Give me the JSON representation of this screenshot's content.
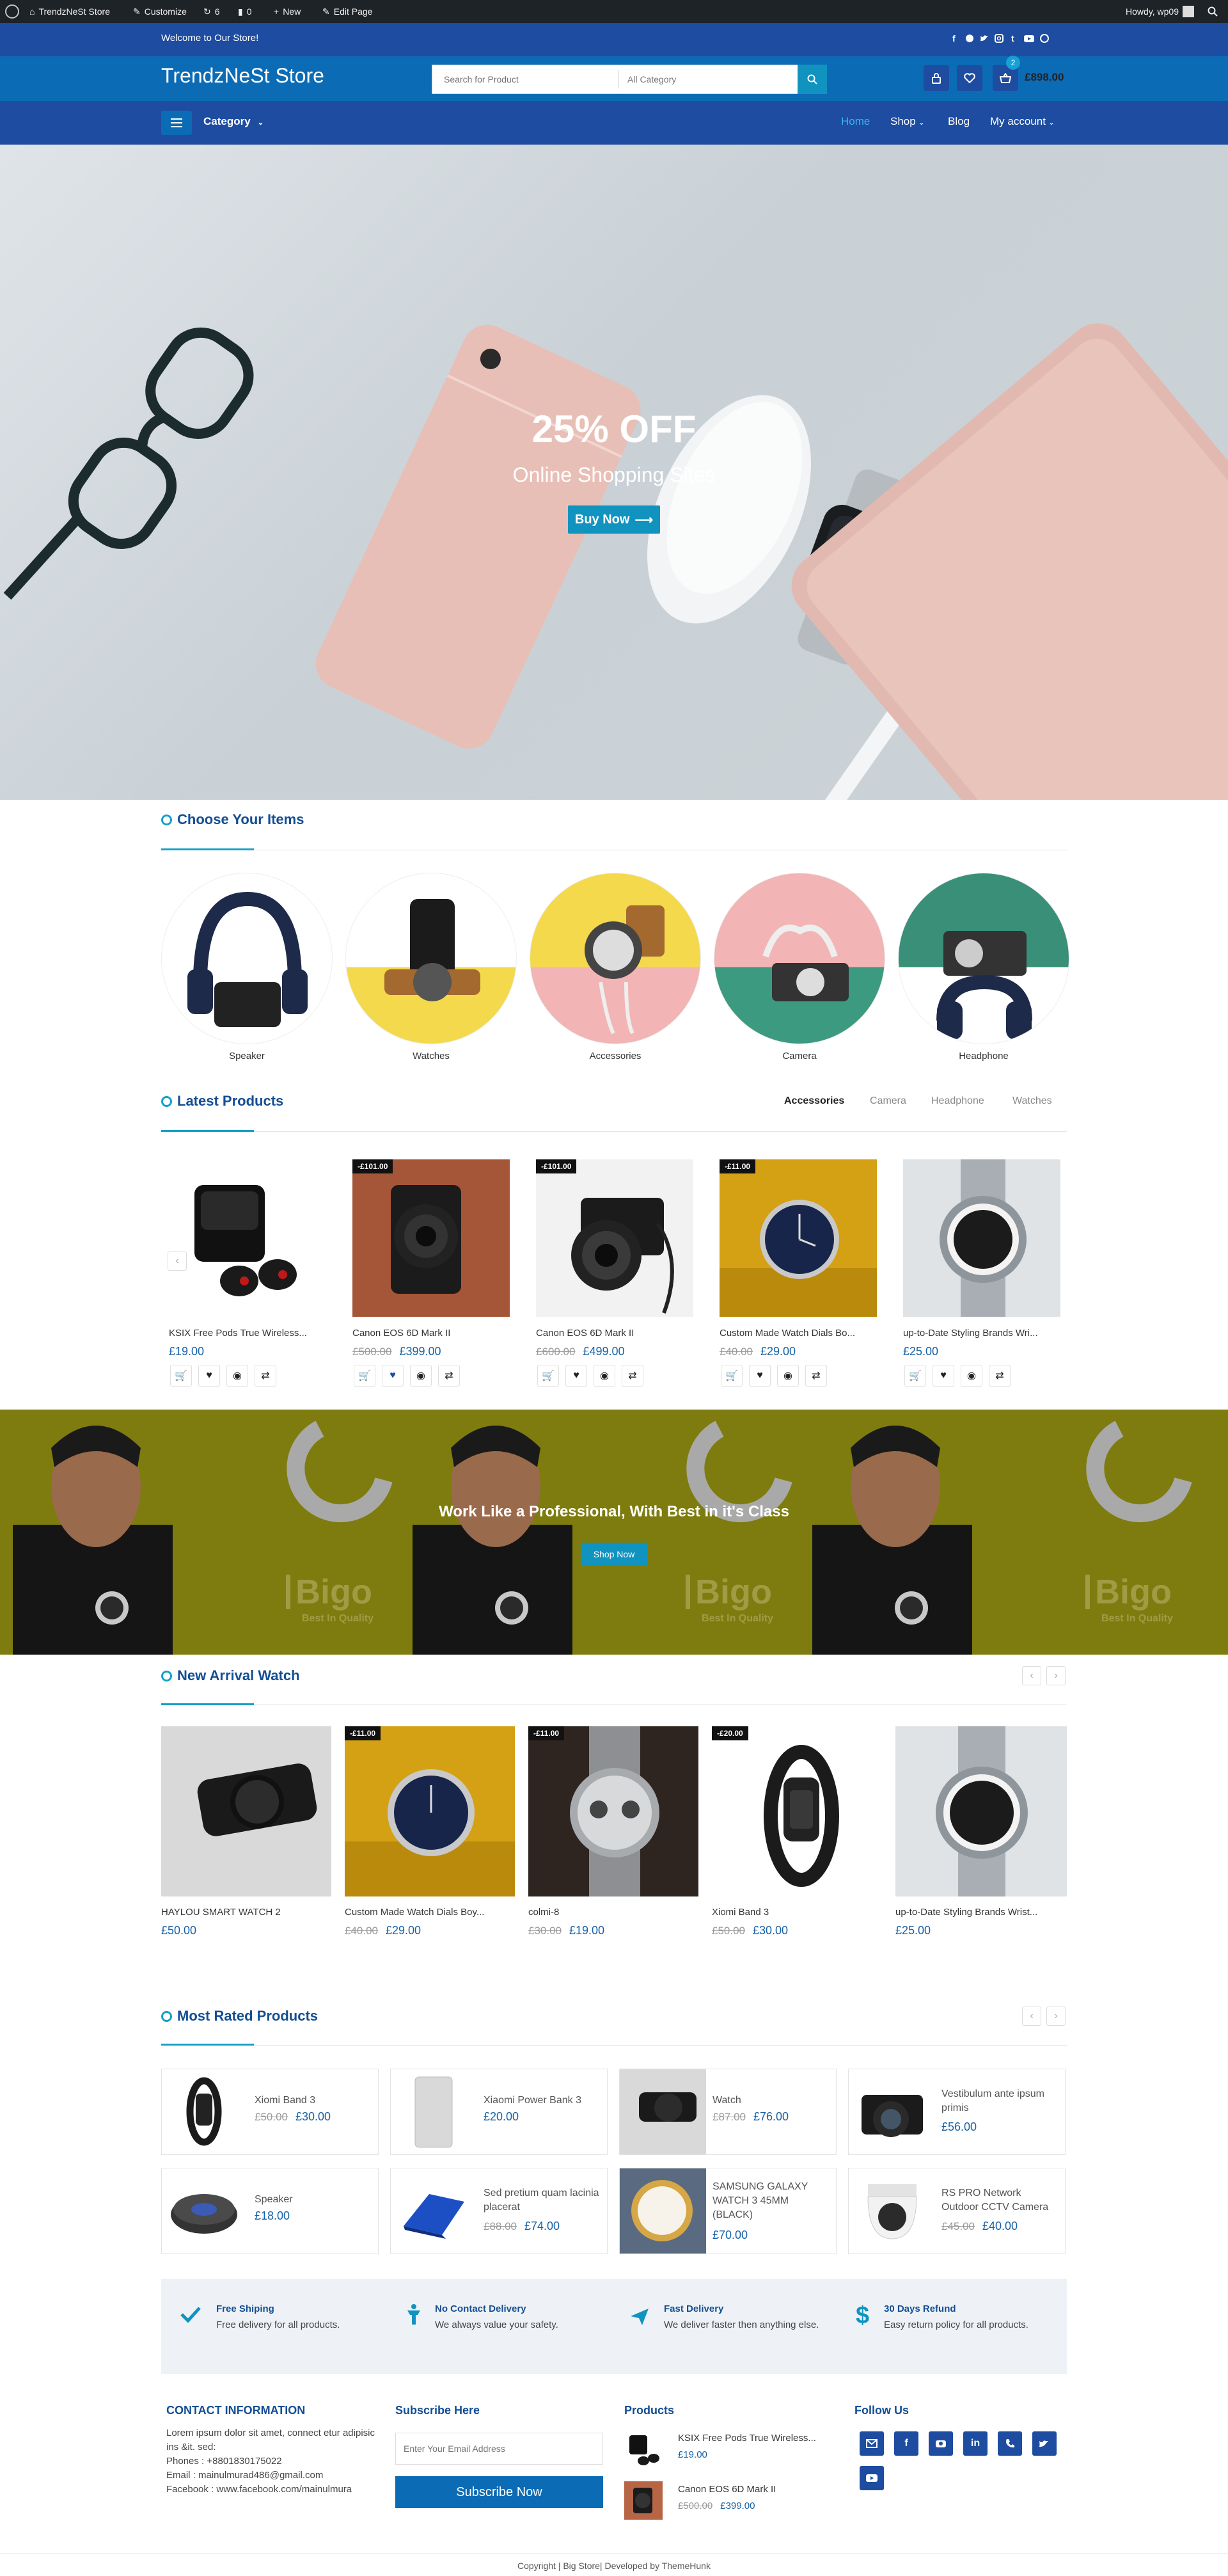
{
  "admin_bar": {
    "site": "TrendzNeSt Store",
    "customize": "Customize",
    "updates": "6",
    "comments": "0",
    "new": "New",
    "edit": "Edit Page",
    "howdy": "Howdy, wp09"
  },
  "topstrip": {
    "welcome": "Welcome to Our Store!"
  },
  "header": {
    "logo": "TrendzNeSt Store",
    "search_placeholder": "Search for Product",
    "category": "All Category",
    "cart_total": "£898.00",
    "cart_count": "2"
  },
  "nav": {
    "category": "Category",
    "links": [
      "Home",
      "Shop",
      "Blog",
      "My account"
    ]
  },
  "hero": {
    "headline": "25% OFF",
    "subline": "Online Shopping Sites",
    "button": "Buy Now"
  },
  "choose": {
    "title": "Choose Your Items",
    "items": [
      "Speaker",
      "Watches",
      "Accessories",
      "Camera",
      "Headphone"
    ]
  },
  "latest": {
    "title": "Latest Products",
    "tabs": [
      "Accessories",
      "Camera",
      "Headphone",
      "Watches"
    ],
    "products": [
      {
        "name": "KSIX Free Pods True Wireless...",
        "old": "",
        "price": "£19.00",
        "badge": ""
      },
      {
        "name": "Canon EOS 6D Mark II",
        "old": "£500.00",
        "price": "£399.00",
        "badge": "-£101.00"
      },
      {
        "name": "Canon EOS 6D Mark II",
        "old": "£600.00",
        "price": "£499.00",
        "badge": "-£101.00"
      },
      {
        "name": "Custom Made Watch Dials Bo...",
        "old": "£40.00",
        "price": "£29.00",
        "badge": "-£11.00"
      },
      {
        "name": "up-to-Date Styling Brands Wri...",
        "old": "",
        "price": "£25.00",
        "badge": ""
      }
    ]
  },
  "promo": {
    "title": "Work Like a Professional, With Best in it's Class",
    "button": "Shop Now",
    "brand": "Bigo",
    "brand_sub": "Best In Quality"
  },
  "arrival": {
    "title": "New Arrival Watch",
    "products": [
      {
        "name": "HAYLOU SMART WATCH 2",
        "old": "",
        "price": "£50.00",
        "badge": ""
      },
      {
        "name": "Custom Made Watch Dials Boy...",
        "old": "£40.00",
        "price": "£29.00",
        "badge": "-£11.00"
      },
      {
        "name": "colmi-8",
        "old": "£30.00",
        "price": "£19.00",
        "badge": "-£11.00"
      },
      {
        "name": "Xiomi Band 3",
        "old": "£50.00",
        "price": "£30.00",
        "badge": "-£20.00"
      },
      {
        "name": "up-to-Date Styling Brands Wrist...",
        "old": "",
        "price": "£25.00",
        "badge": ""
      }
    ]
  },
  "rated": {
    "title": "Most Rated Products",
    "items": [
      {
        "name": "Xiomi Band 3",
        "old": "£50.00",
        "price": "£30.00"
      },
      {
        "name": "Xiaomi Power Bank 3",
        "old": "",
        "price": "£20.00"
      },
      {
        "name": "Watch",
        "old": "£87.00",
        "price": "£76.00"
      },
      {
        "name": "Vestibulum ante ipsum primis",
        "old": "",
        "price": "£56.00"
      },
      {
        "name": "Speaker",
        "old": "",
        "price": "£18.00"
      },
      {
        "name": "Sed pretium quam lacinia placerat",
        "old": "£88.00",
        "price": "£74.00"
      },
      {
        "name": "SAMSUNG GALAXY WATCH 3 45MM (BLACK)",
        "old": "",
        "price": "£70.00"
      },
      {
        "name": "RS PRO Network Outdoor CCTV Camera",
        "old": "£45.00",
        "price": "£40.00"
      }
    ]
  },
  "features": [
    {
      "title": "Free Shiping",
      "text": "Free delivery for all products."
    },
    {
      "title": "No Contact Delivery",
      "text": "We always value your safety."
    },
    {
      "title": "Fast Delivery",
      "text": "We deliver faster then anything else."
    },
    {
      "title": "30 Days Refund",
      "text": "Easy return policy for all products."
    }
  ],
  "footer": {
    "contact_title": "CONTACT INFORMATION",
    "contact_lines": [
      "Lorem ipsum dolor sit amet, connect etur adipisic ins &it. sed:",
      "Phones : +8801830175022",
      "Email : mainulmurad486@gmail.com",
      "Facebook : www.facebook.com/mainulmura"
    ],
    "subscribe_title": "Subscribe Here",
    "subscribe_placeholder": "Enter Your Email Address",
    "subscribe_button": "Subscribe Now",
    "products_title": "Products",
    "products": [
      {
        "name": "KSIX Free Pods True Wireless...",
        "old": "",
        "price": "£19.00"
      },
      {
        "name": "Canon EOS 6D Mark II",
        "old": "£500.00",
        "price": "£399.00"
      }
    ],
    "follow_title": "Follow Us",
    "copyright": "Copyright | Big Store| Developed by ThemeHunk"
  },
  "colors": {
    "primary": "#1e4ca0",
    "header": "#0c6bb5",
    "accent": "#14a0c9",
    "price": "#1761a6"
  }
}
